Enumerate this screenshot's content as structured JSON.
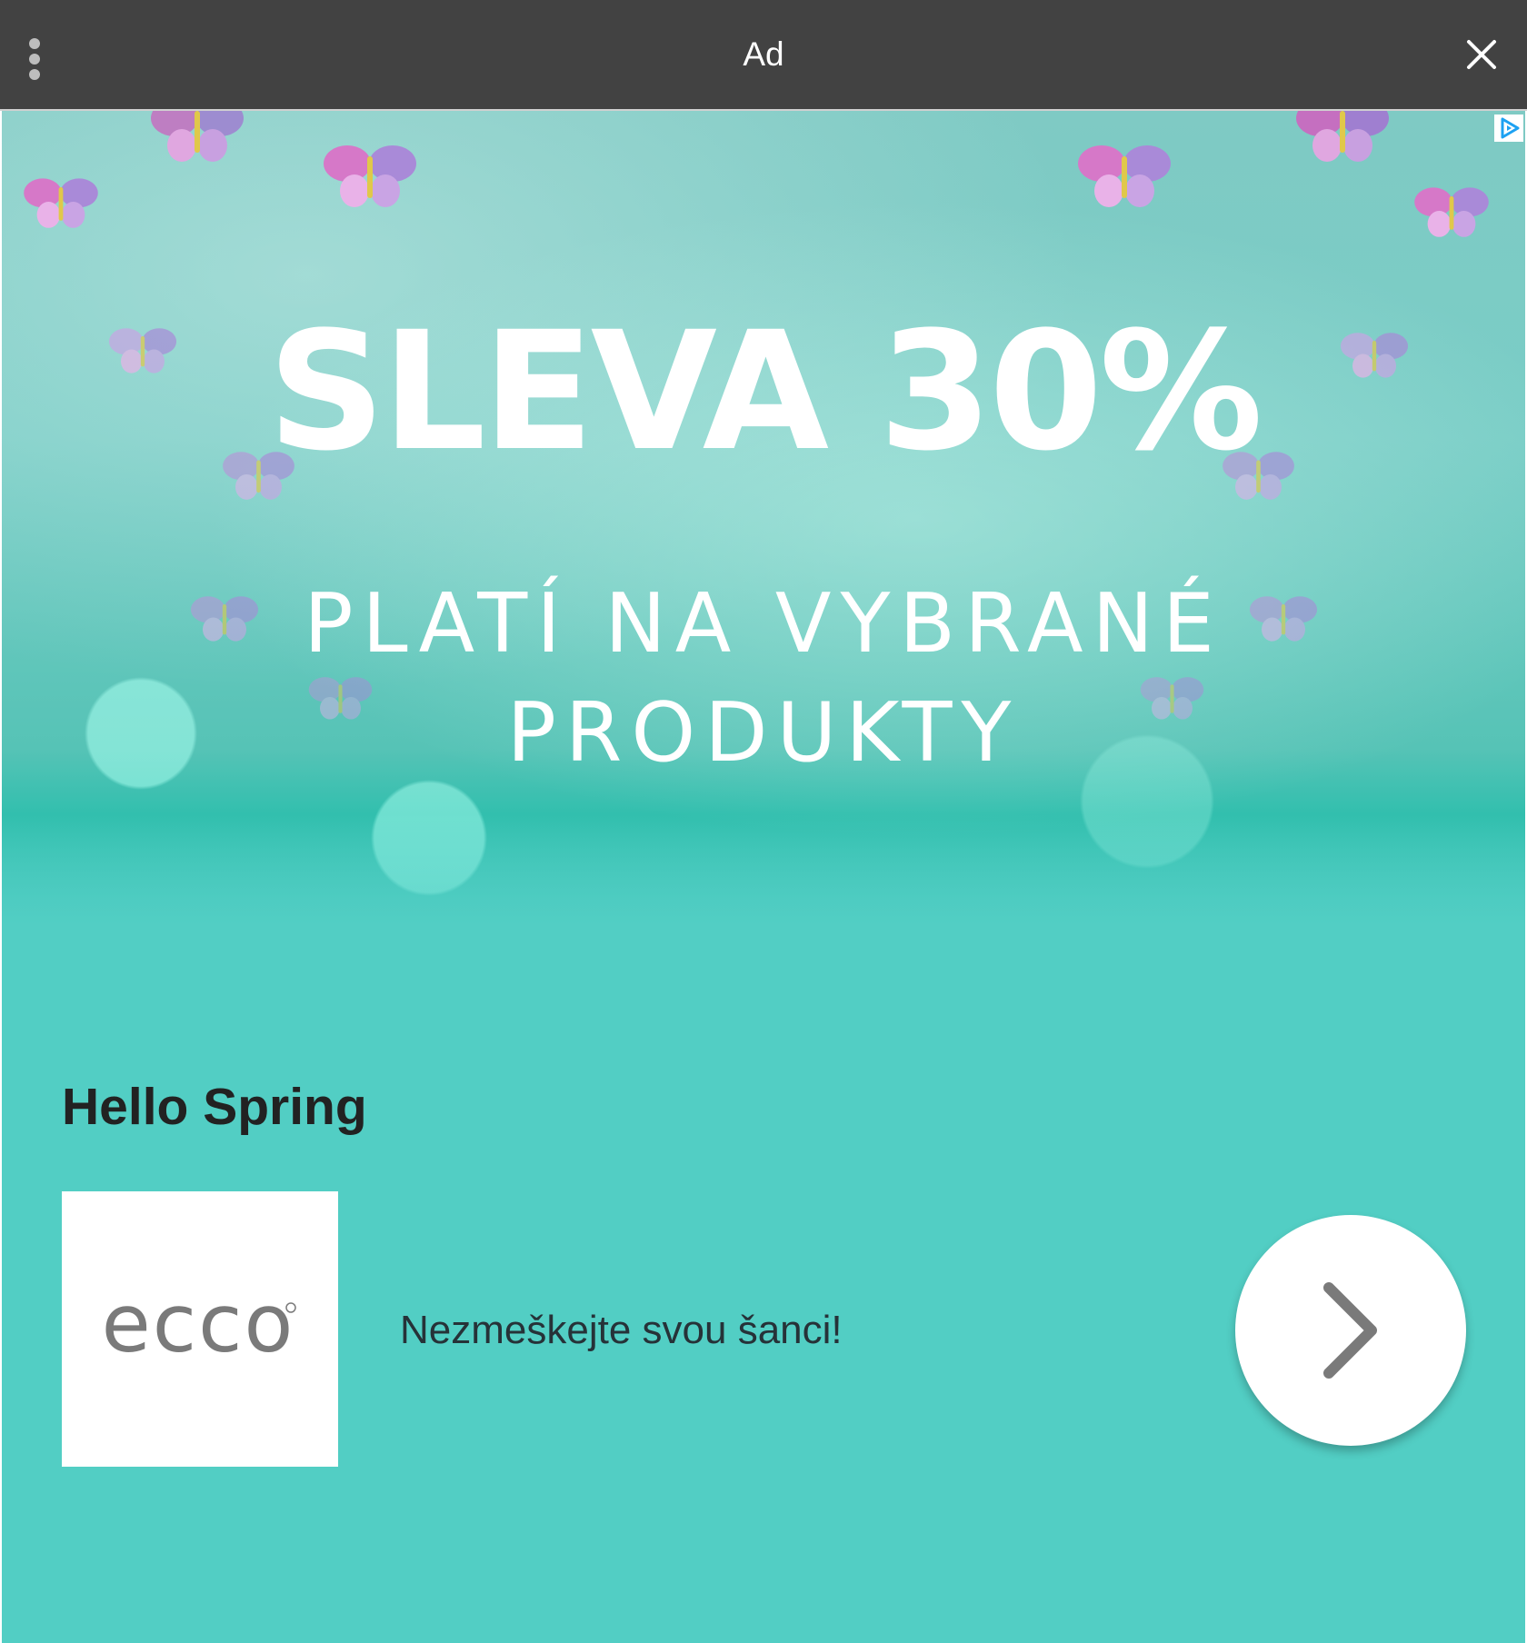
{
  "header": {
    "title": "Ad",
    "background": "#424242",
    "menu_icon": "more-vert-icon",
    "close_icon": "close-icon"
  },
  "creative": {
    "background": "#52cec4",
    "adchoices_icon": "adchoices-icon",
    "banner": {
      "headline": "SLEVA 30%",
      "subline_1": "PLATÍ NA VYBRANÉ",
      "subline_2": "PRODUKTY"
    },
    "title": "Hello Spring",
    "advertiser_logo": {
      "text": "ecco",
      "color": "#7a7a7a"
    },
    "description": "Nezmeškejte svou šanci!",
    "next_icon": "chevron-right-icon"
  }
}
